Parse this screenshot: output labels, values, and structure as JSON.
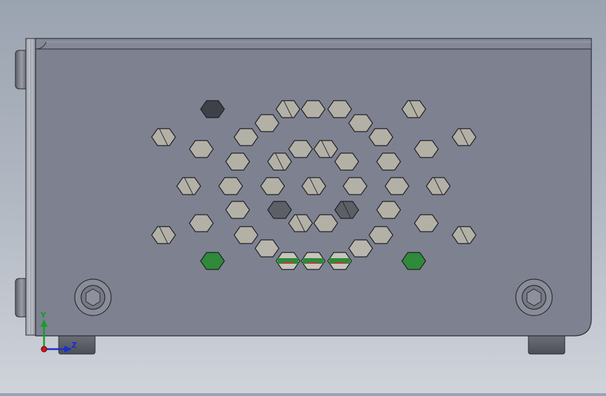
{
  "viewport": {
    "background_top": "#9aa3b0",
    "background_bottom": "#cfd3da"
  },
  "model": {
    "panel_color": "#7e8190",
    "edge_color": "#2a2c33",
    "hole_color": "#b3b1a6",
    "pcb_color": "#2f8a3a",
    "hole_rows": [
      7,
      10,
      6,
      7,
      7,
      8,
      7,
      7,
      3
    ]
  },
  "triad": {
    "y_label": "Y",
    "z_label": "Z",
    "y_color": "#11a02a",
    "z_color": "#1b2fc8",
    "origin_color": "#d01818"
  }
}
